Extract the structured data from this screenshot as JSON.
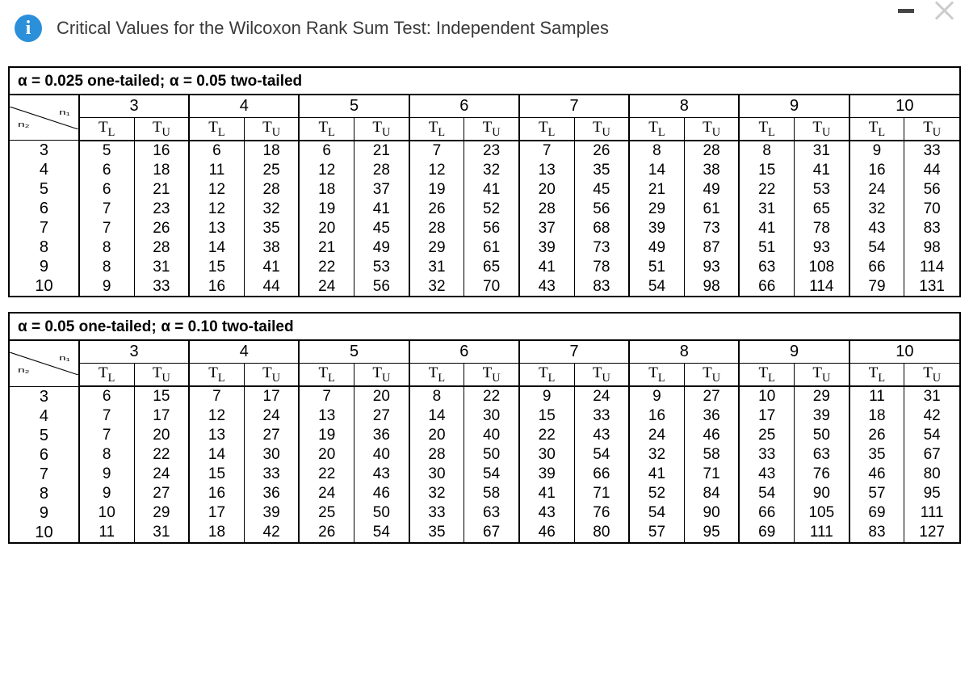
{
  "header": {
    "title": "Critical Values for the Wilcoxon Rank Sum Test: Independent Samples",
    "info_icon": "i"
  },
  "labels": {
    "alpha": "α",
    "eq": "=",
    "one_tailed": "one-tailed;",
    "two_tailed": "two-tailed",
    "TL": "L",
    "TU": "U",
    "T": "T"
  },
  "chart_data": [
    {
      "alpha_one_tailed": "0.025",
      "alpha_two_tailed": "0.05",
      "columns": [
        "3",
        "4",
        "5",
        "6",
        "7",
        "8",
        "9",
        "10"
      ],
      "row_labels": [
        "3",
        "4",
        "5",
        "6",
        "7",
        "8",
        "9",
        "10"
      ],
      "data": [
        [
          [
            5,
            16
          ],
          [
            6,
            18
          ],
          [
            6,
            21
          ],
          [
            7,
            23
          ],
          [
            7,
            26
          ],
          [
            8,
            28
          ],
          [
            8,
            31
          ],
          [
            9,
            33
          ]
        ],
        [
          [
            6,
            18
          ],
          [
            11,
            25
          ],
          [
            12,
            28
          ],
          [
            12,
            32
          ],
          [
            13,
            35
          ],
          [
            14,
            38
          ],
          [
            15,
            41
          ],
          [
            16,
            44
          ]
        ],
        [
          [
            6,
            21
          ],
          [
            12,
            28
          ],
          [
            18,
            37
          ],
          [
            19,
            41
          ],
          [
            20,
            45
          ],
          [
            21,
            49
          ],
          [
            22,
            53
          ],
          [
            24,
            56
          ]
        ],
        [
          [
            7,
            23
          ],
          [
            12,
            32
          ],
          [
            19,
            41
          ],
          [
            26,
            52
          ],
          [
            28,
            56
          ],
          [
            29,
            61
          ],
          [
            31,
            65
          ],
          [
            32,
            70
          ]
        ],
        [
          [
            7,
            26
          ],
          [
            13,
            35
          ],
          [
            20,
            45
          ],
          [
            28,
            56
          ],
          [
            37,
            68
          ],
          [
            39,
            73
          ],
          [
            41,
            78
          ],
          [
            43,
            83
          ]
        ],
        [
          [
            8,
            28
          ],
          [
            14,
            38
          ],
          [
            21,
            49
          ],
          [
            29,
            61
          ],
          [
            39,
            73
          ],
          [
            49,
            87
          ],
          [
            51,
            93
          ],
          [
            54,
            98
          ]
        ],
        [
          [
            8,
            31
          ],
          [
            15,
            41
          ],
          [
            22,
            53
          ],
          [
            31,
            65
          ],
          [
            41,
            78
          ],
          [
            51,
            93
          ],
          [
            63,
            108
          ],
          [
            66,
            114
          ]
        ],
        [
          [
            9,
            33
          ],
          [
            16,
            44
          ],
          [
            24,
            56
          ],
          [
            32,
            70
          ],
          [
            43,
            83
          ],
          [
            54,
            98
          ],
          [
            66,
            114
          ],
          [
            79,
            131
          ]
        ]
      ]
    },
    {
      "alpha_one_tailed": "0.05",
      "alpha_two_tailed": "0.10",
      "columns": [
        "3",
        "4",
        "5",
        "6",
        "7",
        "8",
        "9",
        "10"
      ],
      "row_labels": [
        "3",
        "4",
        "5",
        "6",
        "7",
        "8",
        "9",
        "10"
      ],
      "data": [
        [
          [
            6,
            15
          ],
          [
            7,
            17
          ],
          [
            7,
            20
          ],
          [
            8,
            22
          ],
          [
            9,
            24
          ],
          [
            9,
            27
          ],
          [
            10,
            29
          ],
          [
            11,
            31
          ]
        ],
        [
          [
            7,
            17
          ],
          [
            12,
            24
          ],
          [
            13,
            27
          ],
          [
            14,
            30
          ],
          [
            15,
            33
          ],
          [
            16,
            36
          ],
          [
            17,
            39
          ],
          [
            18,
            42
          ]
        ],
        [
          [
            7,
            20
          ],
          [
            13,
            27
          ],
          [
            19,
            36
          ],
          [
            20,
            40
          ],
          [
            22,
            43
          ],
          [
            24,
            46
          ],
          [
            25,
            50
          ],
          [
            26,
            54
          ]
        ],
        [
          [
            8,
            22
          ],
          [
            14,
            30
          ],
          [
            20,
            40
          ],
          [
            28,
            50
          ],
          [
            30,
            54
          ],
          [
            32,
            58
          ],
          [
            33,
            63
          ],
          [
            35,
            67
          ]
        ],
        [
          [
            9,
            24
          ],
          [
            15,
            33
          ],
          [
            22,
            43
          ],
          [
            30,
            54
          ],
          [
            39,
            66
          ],
          [
            41,
            71
          ],
          [
            43,
            76
          ],
          [
            46,
            80
          ]
        ],
        [
          [
            9,
            27
          ],
          [
            16,
            36
          ],
          [
            24,
            46
          ],
          [
            32,
            58
          ],
          [
            41,
            71
          ],
          [
            52,
            84
          ],
          [
            54,
            90
          ],
          [
            57,
            95
          ]
        ],
        [
          [
            10,
            29
          ],
          [
            17,
            39
          ],
          [
            25,
            50
          ],
          [
            33,
            63
          ],
          [
            43,
            76
          ],
          [
            54,
            90
          ],
          [
            66,
            105
          ],
          [
            69,
            111
          ]
        ],
        [
          [
            11,
            31
          ],
          [
            18,
            42
          ],
          [
            26,
            54
          ],
          [
            35,
            67
          ],
          [
            46,
            80
          ],
          [
            57,
            95
          ],
          [
            69,
            111
          ],
          [
            83,
            127
          ]
        ]
      ]
    }
  ]
}
